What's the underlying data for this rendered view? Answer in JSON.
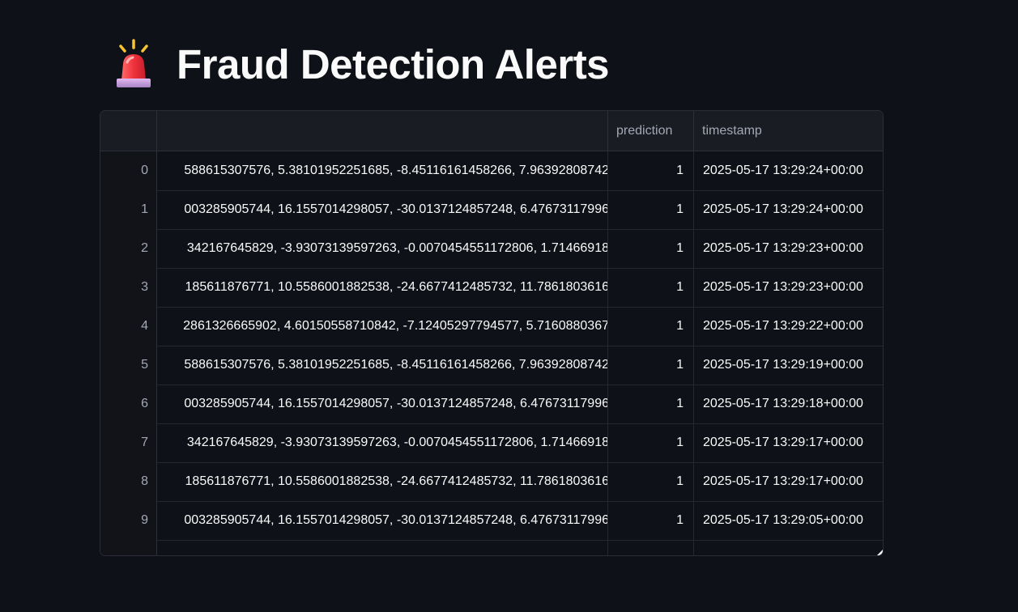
{
  "page": {
    "title": "Fraud Detection Alerts",
    "title_icon": "siren-icon"
  },
  "colors": {
    "background": "#0e1117",
    "header_bg": "#1a1c24",
    "text": "#fafafa",
    "muted_text": "#a3a8b4",
    "grid_border": "#2e3039"
  },
  "table": {
    "columns": {
      "index": "",
      "features": "",
      "prediction": "prediction",
      "timestamp": "timestamp"
    },
    "rows": [
      {
        "index": "0",
        "features": "588615307576, 5.38101952251685, -8.45116161458266, 7.96392808742",
        "prediction": "1",
        "timestamp": "2025-05-17 13:29:24+00:00"
      },
      {
        "index": "1",
        "features": "003285905744, 16.1557014298057, -30.0137124857248, 6.47673117996",
        "prediction": "1",
        "timestamp": "2025-05-17 13:29:24+00:00"
      },
      {
        "index": "2",
        "features": "342167645829, -3.93073139597263, -0.0070454551172806, 1.71466918",
        "prediction": "1",
        "timestamp": "2025-05-17 13:29:23+00:00"
      },
      {
        "index": "3",
        "features": "185611876771, 10.5586001882538, -24.6677412485732, 11.7861803616",
        "prediction": "1",
        "timestamp": "2025-05-17 13:29:23+00:00"
      },
      {
        "index": "4",
        "features": "2861326665902, 4.60150558710842, -7.12405297794577, 5.7160880367",
        "prediction": "1",
        "timestamp": "2025-05-17 13:29:22+00:00"
      },
      {
        "index": "5",
        "features": "588615307576, 5.38101952251685, -8.45116161458266, 7.96392808742",
        "prediction": "1",
        "timestamp": "2025-05-17 13:29:19+00:00"
      },
      {
        "index": "6",
        "features": "003285905744, 16.1557014298057, -30.0137124857248, 6.47673117996",
        "prediction": "1",
        "timestamp": "2025-05-17 13:29:18+00:00"
      },
      {
        "index": "7",
        "features": "342167645829, -3.93073139597263, -0.0070454551172806, 1.71466918",
        "prediction": "1",
        "timestamp": "2025-05-17 13:29:17+00:00"
      },
      {
        "index": "8",
        "features": "185611876771, 10.5586001882538, -24.6677412485732, 11.7861803616",
        "prediction": "1",
        "timestamp": "2025-05-17 13:29:17+00:00"
      },
      {
        "index": "9",
        "features": "003285905744, 16.1557014298057, -30.0137124857248, 6.47673117996",
        "prediction": "1",
        "timestamp": "2025-05-17 13:29:05+00:00"
      },
      {
        "index": "",
        "features": "",
        "prediction": "",
        "timestamp": ""
      }
    ]
  }
}
